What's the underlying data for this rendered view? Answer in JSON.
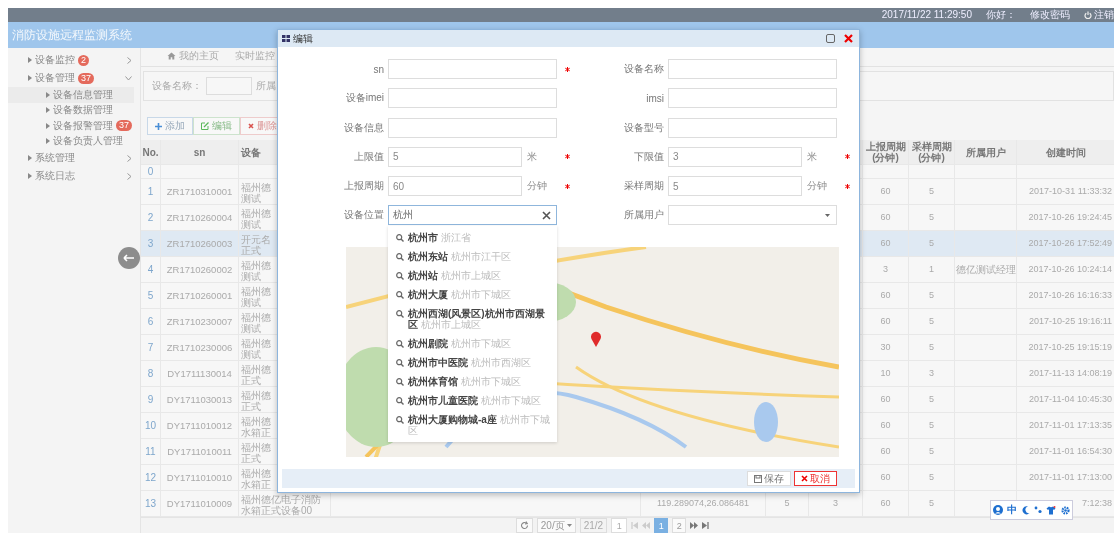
{
  "top_bar": {
    "datetime": "2017/11/22 11:29:50",
    "greeting": "你好：",
    "change_password": "修改密码",
    "logout": "注销"
  },
  "app_title": "消防设施远程监测系统",
  "sidebar": {
    "items": [
      {
        "label": "设备监控",
        "badge": "2",
        "expanded": false
      },
      {
        "label": "设备管理",
        "badge": "37",
        "expanded": true,
        "children": [
          {
            "label": "设备信息管理",
            "selected": true
          },
          {
            "label": "设备数据管理",
            "selected": false
          },
          {
            "label": "设备报警管理",
            "badge": "37",
            "selected": false
          },
          {
            "label": "设备负责人管理",
            "selected": false
          }
        ]
      },
      {
        "label": "系统管理",
        "expanded": false
      },
      {
        "label": "系统日志",
        "expanded": false
      }
    ]
  },
  "tabs": [
    {
      "label": "我的主页",
      "kind": "home"
    },
    {
      "label": "实时监控",
      "kind": "closable"
    }
  ],
  "search": {
    "name_label": "设备名称：",
    "owner_label": "所属"
  },
  "toolbar": [
    {
      "label": "添加",
      "kind": "add"
    },
    {
      "label": "编辑",
      "kind": "edit"
    },
    {
      "label": "删除",
      "kind": "delete"
    }
  ],
  "table": {
    "headers": {
      "no": "No.",
      "sn": "sn",
      "device": "设备",
      "report_period": [
        "上报周期",
        "(分钟)"
      ],
      "sample_period": [
        "采样周期",
        "(分钟)"
      ],
      "user": "所属用户",
      "created": "创建时间"
    },
    "rows": [
      {
        "no": "0",
        "selected": false
      },
      {
        "no": "1",
        "sn": "ZR1710310001",
        "device": [
          "福州德",
          "测试"
        ],
        "report_period": "60",
        "sample_period": "5",
        "created": "2017-10-31 11:33:32",
        "selected": false
      },
      {
        "no": "2",
        "sn": "ZR1710260004",
        "device": [
          "福州德",
          "测试"
        ],
        "report_period": "60",
        "sample_period": "5",
        "created": "2017-10-26 19:24:45",
        "selected": false
      },
      {
        "no": "3",
        "sn": "ZR1710260003",
        "device": [
          "开元名",
          "正式"
        ],
        "report_period": "60",
        "sample_period": "5",
        "created": "2017-10-26 17:52:49",
        "selected": true
      },
      {
        "no": "4",
        "sn": "ZR1710260002",
        "device": [
          "福州德",
          "测试"
        ],
        "report_period": "3",
        "sample_period": "1",
        "user": "德亿测试经理",
        "created": "2017-10-26 10:24:14",
        "selected": false
      },
      {
        "no": "5",
        "sn": "ZR1710260001",
        "device": [
          "福州德",
          "测试"
        ],
        "report_period": "60",
        "sample_period": "5",
        "created": "2017-10-26 16:16:33",
        "selected": false
      },
      {
        "no": "6",
        "sn": "ZR1710230007",
        "device": [
          "福州德",
          "测试"
        ],
        "report_period": "60",
        "sample_period": "5",
        "created": "2017-10-25 19:16:11",
        "selected": false
      },
      {
        "no": "7",
        "sn": "ZR1710230006",
        "device": [
          "福州德",
          "测试"
        ],
        "report_period": "30",
        "sample_period": "5",
        "created": "2017-10-25 19:15:19",
        "selected": false
      },
      {
        "no": "8",
        "sn": "DY1711130014",
        "device": [
          "福州德",
          "正式"
        ],
        "report_period": "10",
        "sample_period": "3",
        "created": "2017-11-13 14:08:19",
        "selected": false
      },
      {
        "no": "9",
        "sn": "DY1711030013",
        "device": [
          "福州德",
          "正式"
        ],
        "report_period": "60",
        "sample_period": "5",
        "created": "2017-11-04 10:45:30",
        "selected": false
      },
      {
        "no": "10",
        "sn": "DY1711010012",
        "device": [
          "福州德",
          "水箱正"
        ],
        "report_period": "60",
        "sample_period": "5",
        "created": "2017-11-01 17:13:35",
        "selected": false
      },
      {
        "no": "11",
        "sn": "DY1711010011",
        "device": [
          "福州德",
          "正式"
        ],
        "report_period": "60",
        "sample_period": "5",
        "created": "2017-11-01 16:54:30",
        "selected": false
      },
      {
        "no": "12",
        "sn": "DY1711010010",
        "device": [
          "福州德",
          "水箱正"
        ],
        "report_period": "60",
        "sample_period": "5",
        "created": "2017-11-01 17:13:00",
        "selected": false
      },
      {
        "no": "13",
        "sn": "DY1711010009",
        "device": [
          "福州德亿电子消防",
          "水箱正式设备00"
        ],
        "column_4": "119.289074,26.086481",
        "column_5": "5",
        "column_6": "3",
        "report_period": "60",
        "sample_period": "5",
        "created": "7:12:38",
        "selected": false
      }
    ]
  },
  "pagination": {
    "page_size": "20/页",
    "summary": "21/2",
    "page_input": "1",
    "pages": [
      {
        "label": "1",
        "selected": true
      },
      {
        "label": "2",
        "selected": false
      }
    ]
  },
  "modal": {
    "title": "编辑",
    "fields": [
      {
        "label": "sn",
        "kind": "text",
        "required": true
      },
      {
        "label": "设备名称",
        "kind": "text",
        "required": false
      },
      {
        "label": "设备imei",
        "kind": "text",
        "required": false
      },
      {
        "label": "imsi",
        "kind": "text",
        "required": false
      },
      {
        "label": "设备信息",
        "kind": "text",
        "required": false
      },
      {
        "label": "设备型号",
        "kind": "text",
        "required": false
      },
      {
        "label": "上限值",
        "kind": "text",
        "value": "5",
        "unit": "米",
        "required": true
      },
      {
        "label": "下限值",
        "kind": "text",
        "value": "3",
        "unit": "米",
        "required": true
      },
      {
        "label": "上报周期",
        "kind": "text",
        "value": "60",
        "unit": "分钟",
        "required": true
      },
      {
        "label": "采样周期",
        "kind": "text",
        "value": "5",
        "unit": "分钟",
        "required": true
      },
      {
        "label": "设备位置",
        "kind": "search",
        "value": "杭州",
        "required": false,
        "suggestions": [
          {
            "name": "杭州市",
            "region": "浙江省"
          },
          {
            "name": "杭州东站",
            "region": "杭州市江干区"
          },
          {
            "name": "杭州站",
            "region": "杭州市上城区"
          },
          {
            "name": "杭州大厦",
            "region": "杭州市下城区"
          },
          {
            "name": "杭州西湖(风景区)杭州市西湖景区",
            "region": "杭州市上城区"
          },
          {
            "name": "杭州剧院",
            "region": "杭州市下城区"
          },
          {
            "name": "杭州市中医院",
            "region": "杭州市西湖区"
          },
          {
            "name": "杭州体育馆",
            "region": "杭州市下城区"
          },
          {
            "name": "杭州市儿童医院",
            "region": "杭州市下城区"
          },
          {
            "name": "杭州大厦购物城-a座",
            "region": "杭州市下城区"
          }
        ]
      },
      {
        "label": "所属用户",
        "kind": "select",
        "required": false
      }
    ],
    "buttons": [
      {
        "label": "保存",
        "kind": "save"
      },
      {
        "label": "取消",
        "kind": "cancel"
      }
    ]
  },
  "ime_toolbar": {
    "mode": "中"
  }
}
